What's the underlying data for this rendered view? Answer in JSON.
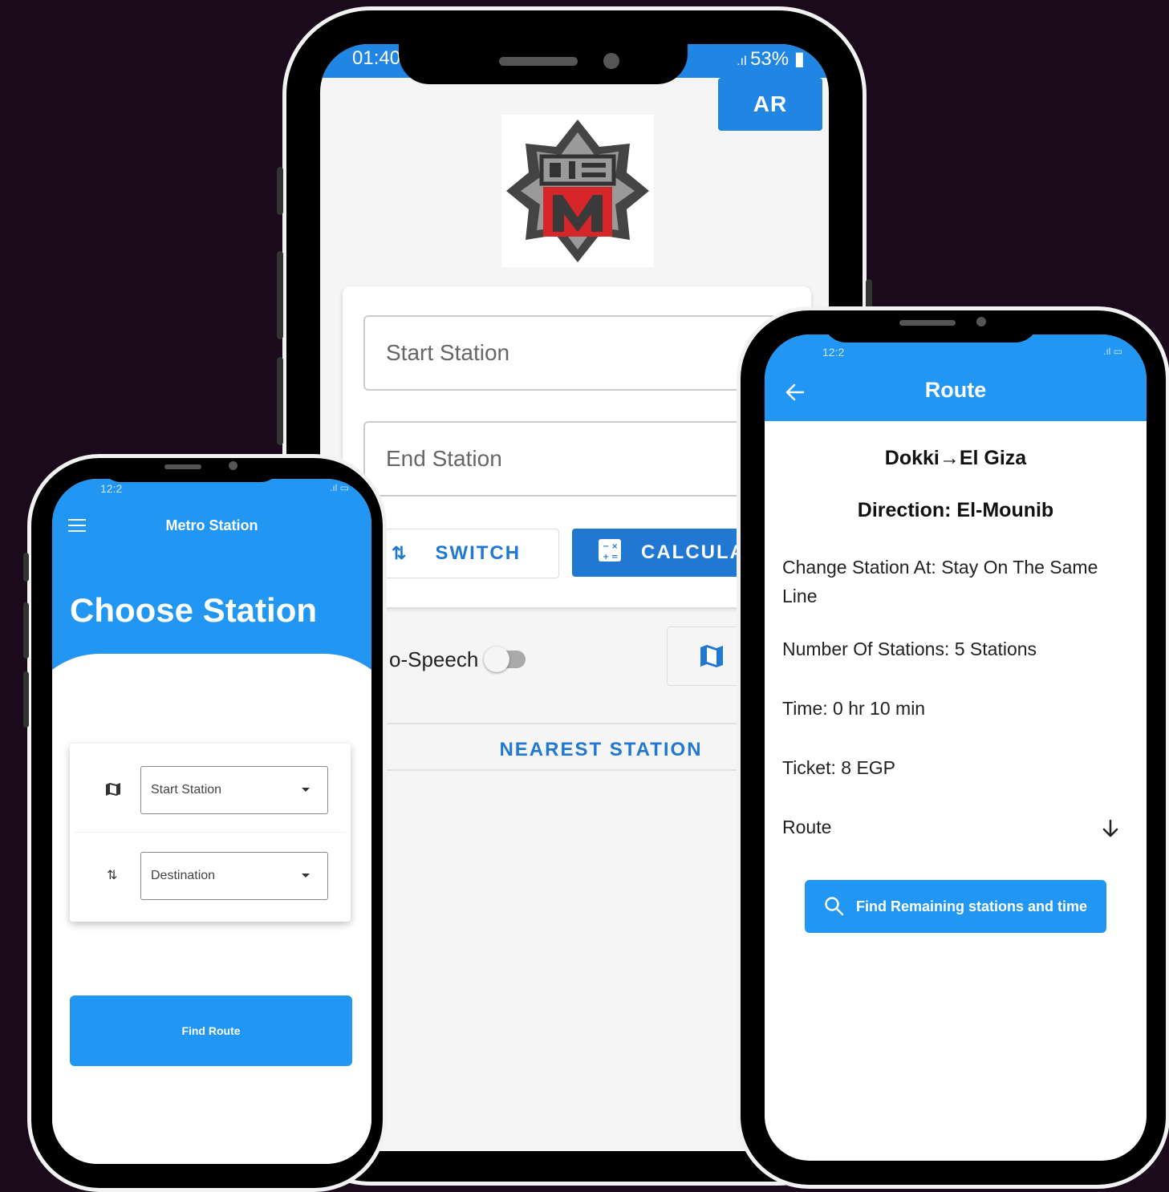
{
  "colors": {
    "background": "#1b0a1c",
    "primary": "#2196f3",
    "primary_dark": "#2178d3"
  },
  "center_phone": {
    "status_time": "01:40",
    "status_battery": "53%",
    "language_button": "AR",
    "logo_icon": "metro-logo-icon",
    "start_placeholder": "Start Station",
    "end_placeholder": "End Station",
    "switch_label": "SWITCH",
    "calculate_label": "CALCULA",
    "speech_label": "o-Speech",
    "nearest_label": "NEAREST STATION"
  },
  "left_phone": {
    "status_time": "12:2",
    "app_title": "Metro Station",
    "heading": "Choose Station",
    "start_field": "Start Station",
    "destination_field": "Destination",
    "find_button": "Find Route"
  },
  "right_phone": {
    "status_time": "12:2",
    "app_title": "Route",
    "route_title": "Dokki→El Giza",
    "direction": "Direction: El-Mounib",
    "change_station": "Change Station At: Stay On The Same Line",
    "number_of_stations": "Number Of Stations: 5 Stations",
    "time": "Time: 0 hr  10 min",
    "ticket": "Ticket: 8 EGP",
    "route_label": "Route",
    "find_remaining_button": "Find Remaining stations and time"
  }
}
